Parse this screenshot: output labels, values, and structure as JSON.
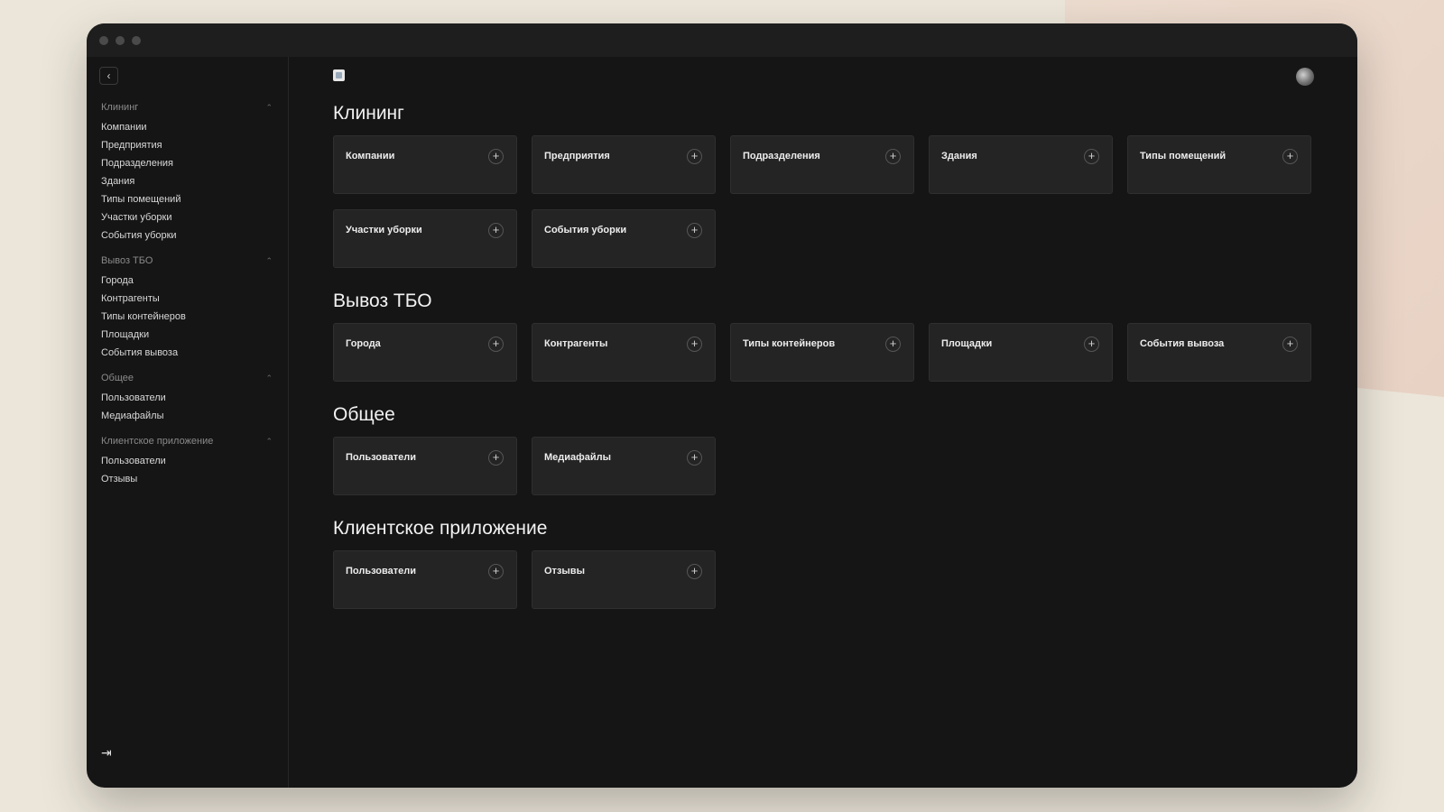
{
  "sidebar": {
    "collapse_icon": "chevron-left-icon",
    "groups": [
      {
        "title": "Клининг",
        "items": [
          "Компании",
          "Предприятия",
          "Подразделения",
          "Здания",
          "Типы помещений",
          "Участки уборки",
          "События уборки"
        ]
      },
      {
        "title": "Вывоз ТБО",
        "items": [
          "Города",
          "Контрагенты",
          "Типы контейнеров",
          "Площадки",
          "События вывоза"
        ]
      },
      {
        "title": "Общее",
        "items": [
          "Пользователи",
          "Медиафайлы"
        ]
      },
      {
        "title": "Клиентское приложение",
        "items": [
          "Пользователи",
          "Отзывы"
        ]
      }
    ],
    "logout_icon": "logout-icon"
  },
  "main": {
    "sections": [
      {
        "title": "Клининг",
        "cards": [
          "Компании",
          "Предприятия",
          "Подразделения",
          "Здания",
          "Типы помещений",
          "Участки уборки",
          "События уборки"
        ]
      },
      {
        "title": "Вывоз ТБО",
        "cards": [
          "Города",
          "Контрагенты",
          "Типы контейнеров",
          "Площадки",
          "События вывоза"
        ]
      },
      {
        "title": "Общее",
        "cards": [
          "Пользователи",
          "Медиафайлы"
        ]
      },
      {
        "title": "Клиентское приложение",
        "cards": [
          "Пользователи",
          "Отзывы"
        ]
      }
    ]
  },
  "colors": {
    "window_bg": "#151515",
    "card_bg": "#242424",
    "page_bg": "#ece6da"
  }
}
